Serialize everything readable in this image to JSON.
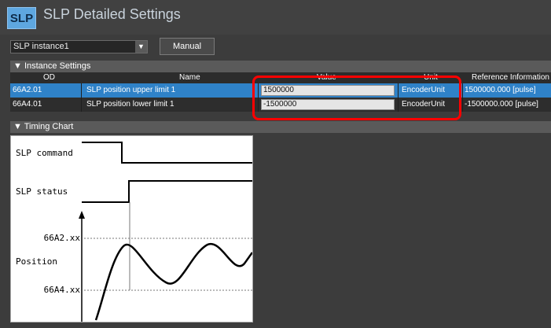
{
  "app": {
    "logo_text": "SLP",
    "title": "SLP Detailed Settings"
  },
  "toolbar": {
    "instance_selected": "SLP instance1",
    "manual_button": "Manual"
  },
  "instance_settings": {
    "header": "▼ Instance Settings",
    "columns": {
      "od": "OD",
      "name": "Name",
      "value": "Value",
      "unit": "Unit",
      "reference": "Reference Information"
    },
    "rows": [
      {
        "od": "66A2.01",
        "name": "SLP position upper limit 1",
        "value": "1500000",
        "unit": "EncoderUnit",
        "reference": "1500000.000 [pulse]"
      },
      {
        "od": "66A4.01",
        "name": "SLP position lower limit 1",
        "value": "-1500000",
        "unit": "EncoderUnit",
        "reference": "-1500000.000 [pulse]"
      }
    ]
  },
  "timing_chart": {
    "header": "▼ Timing Chart",
    "labels": {
      "command": "SLP command",
      "status": "SLP status",
      "upper": "66A2.xx",
      "position": "Position",
      "lower": "66A4.xx"
    }
  },
  "colors": {
    "selected_row": "#2f82c8",
    "highlight": "#ff0000",
    "logo": "#5ea7e0"
  }
}
